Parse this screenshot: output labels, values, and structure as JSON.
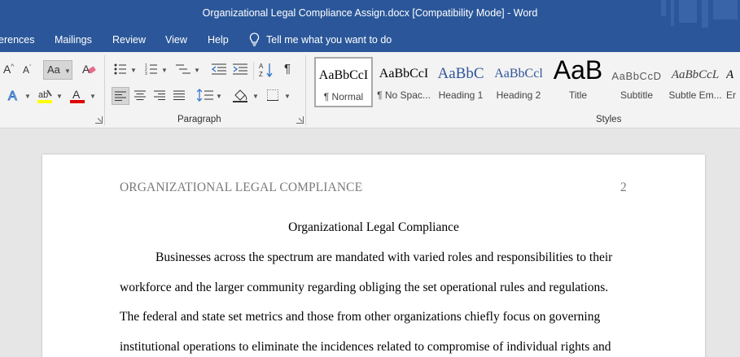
{
  "window": {
    "title": "Organizational Legal Compliance Assign.docx [Compatibility Mode]  -  Word"
  },
  "tabs": [
    "erences",
    "Mailings",
    "Review",
    "View",
    "Help"
  ],
  "tell_me": "Tell me what you want to do",
  "ribbon": {
    "paragraph_label": "Paragraph",
    "styles_label": "Styles",
    "font_case_label": "Aa",
    "styles": [
      {
        "sample": "AaBbCcI",
        "name": "¶ Normal"
      },
      {
        "sample": "AaBbCcI",
        "name": "¶ No Spac..."
      },
      {
        "sample": "AaBbC",
        "name": "Heading 1"
      },
      {
        "sample": "AaBbCcl",
        "name": "Heading 2"
      },
      {
        "sample": "AaB",
        "name": "Title"
      },
      {
        "sample": "AaBbCcD",
        "name": "Subtitle"
      },
      {
        "sample": "AaBbCcL",
        "name": "Subtle Em..."
      },
      {
        "sample": "A",
        "name": "Er"
      }
    ],
    "colors": {
      "highlight": "#ffff00",
      "font_color": "#e00000",
      "accent": "#2b579a"
    }
  },
  "document": {
    "running_head": "ORGANIZATIONAL LEGAL COMPLIANCE",
    "page_number": "2",
    "title": "Organizational Legal Compliance",
    "lines": [
      "Businesses across the spectrum are mandated with varied roles and responsibilities to their",
      "workforce and the larger community regarding obliging the set operational rules and regulations.",
      "The federal and state set metrics and those from other organizations chiefly focus on governing",
      "institutional operations to eliminate the incidences related to compromise of individual rights and"
    ]
  }
}
